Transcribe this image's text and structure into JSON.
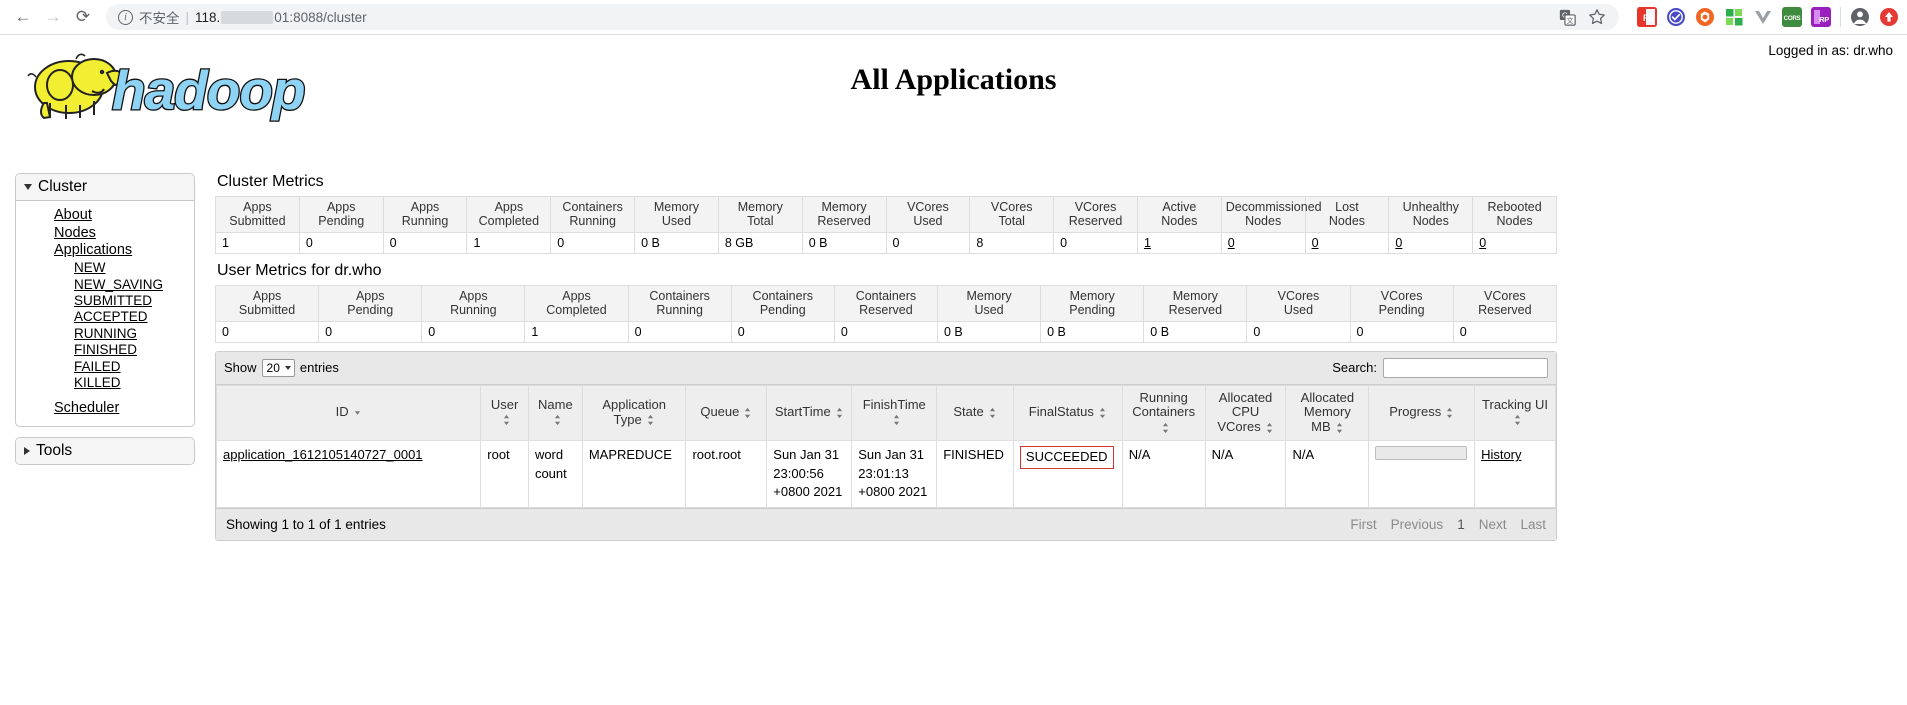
{
  "browser": {
    "back_icon": "back-arrow-icon",
    "forward_icon": "forward-arrow-icon",
    "reload_icon": "reload-icon",
    "security_label": "不安全",
    "url_host": "118.",
    "url_port_path": "01:8088/cluster",
    "translate_icon": "translate-icon",
    "bookmark_icon": "star-icon",
    "extensions": [
      {
        "name": "fe-extension",
        "label": "FE",
        "color": "#e8352c"
      },
      {
        "name": "check-circle-extension",
        "label": "✓",
        "color": "#4b4bc8"
      },
      {
        "name": "orange-hex-extension",
        "label": "",
        "color": "#f26522"
      },
      {
        "name": "green-grid-extension",
        "label": "",
        "color": "#2fae4f"
      },
      {
        "name": "vue-extension",
        "label": "V",
        "color": "#9aa0a6"
      },
      {
        "name": "cors-extension",
        "label": "CORS",
        "color": "#3e8b3e"
      },
      {
        "name": "rp-extension",
        "label": "RP",
        "color": "#9b1fbf"
      }
    ],
    "profile_icon": "profile-avatar-icon",
    "menu_icon": "update-menu-icon"
  },
  "header": {
    "logged_in": "Logged in as: dr.who",
    "logo_text": "hadoop",
    "title": "All Applications"
  },
  "sidebar": {
    "cluster": {
      "label": "Cluster",
      "links": [
        {
          "label": "About",
          "name": "sidebar-link-about"
        },
        {
          "label": "Nodes",
          "name": "sidebar-link-nodes"
        },
        {
          "label": "Applications",
          "name": "sidebar-link-applications"
        }
      ],
      "app_states": [
        "NEW",
        "NEW_SAVING",
        "SUBMITTED",
        "ACCEPTED",
        "RUNNING",
        "FINISHED",
        "FAILED",
        "KILLED"
      ],
      "scheduler": "Scheduler"
    },
    "tools": {
      "label": "Tools"
    }
  },
  "cluster_metrics": {
    "title": "Cluster Metrics",
    "headers": [
      [
        "Apps",
        "Submitted"
      ],
      [
        "Apps",
        "Pending"
      ],
      [
        "Apps",
        "Running"
      ],
      [
        "Apps",
        "Completed"
      ],
      [
        "Containers",
        "Running"
      ],
      [
        "Memory",
        "Used"
      ],
      [
        "Memory",
        "Total"
      ],
      [
        "Memory",
        "Reserved"
      ],
      [
        "VCores",
        "Used"
      ],
      [
        "VCores",
        "Total"
      ],
      [
        "VCores",
        "Reserved"
      ],
      [
        "Active",
        "Nodes"
      ],
      [
        "Decommissioned",
        "Nodes"
      ],
      [
        "Lost",
        "Nodes"
      ],
      [
        "Unhealthy",
        "Nodes"
      ],
      [
        "Rebooted",
        "Nodes"
      ]
    ],
    "values": [
      "1",
      "0",
      "0",
      "1",
      "0",
      "0 B",
      "8 GB",
      "0 B",
      "0",
      "8",
      "0",
      "1",
      "0",
      "0",
      "0",
      "0"
    ],
    "linked": [
      false,
      false,
      false,
      false,
      false,
      false,
      false,
      false,
      false,
      false,
      false,
      true,
      true,
      true,
      true,
      true
    ]
  },
  "user_metrics": {
    "title": "User Metrics for dr.who",
    "headers": [
      [
        "Apps",
        "Submitted"
      ],
      [
        "Apps",
        "Pending"
      ],
      [
        "Apps",
        "Running"
      ],
      [
        "Apps",
        "Completed"
      ],
      [
        "Containers",
        "Running"
      ],
      [
        "Containers",
        "Pending"
      ],
      [
        "Containers",
        "Reserved"
      ],
      [
        "Memory",
        "Used"
      ],
      [
        "Memory",
        "Pending"
      ],
      [
        "Memory",
        "Reserved"
      ],
      [
        "VCores",
        "Used"
      ],
      [
        "VCores",
        "Pending"
      ],
      [
        "VCores",
        "Reserved"
      ]
    ],
    "values": [
      "0",
      "0",
      "0",
      "1",
      "0",
      "0",
      "0",
      "0 B",
      "0 B",
      "0 B",
      "0",
      "0",
      "0"
    ]
  },
  "apps_table": {
    "show_label": "Show",
    "entries_label": "entries",
    "page_length": "20",
    "search_label": "Search:",
    "search_value": "",
    "search_placeholder": "",
    "columns": [
      "ID",
      "User",
      "Name",
      "Application Type",
      "Queue",
      "StartTime",
      "FinishTime",
      "State",
      "FinalStatus",
      "Running Containers",
      "Allocated CPU VCores",
      "Allocated Memory MB",
      "Progress",
      "Tracking UI"
    ],
    "rows": [
      {
        "id": "application_1612105140727_0001",
        "user": "root",
        "name": "word count",
        "app_type": "MAPREDUCE",
        "queue": "root.root",
        "start_time": "Sun Jan 31 23:00:56 +0800 2021",
        "finish_time": "Sun Jan 31 23:01:13 +0800 2021",
        "state": "FINISHED",
        "final_status": "SUCCEEDED",
        "running_containers": "N/A",
        "allocated_vcores": "N/A",
        "allocated_memory": "N/A",
        "progress": "",
        "tracking_ui": "History"
      }
    ],
    "footer_info": "Showing 1 to 1 of 1 entries",
    "pager": {
      "first": "First",
      "previous": "Previous",
      "page": "1",
      "next": "Next",
      "last": "Last"
    }
  },
  "colors": {
    "accent_red": "#d0342c",
    "logo_blue": "#8fd3f4",
    "logo_yellow": "#f2ef33"
  }
}
